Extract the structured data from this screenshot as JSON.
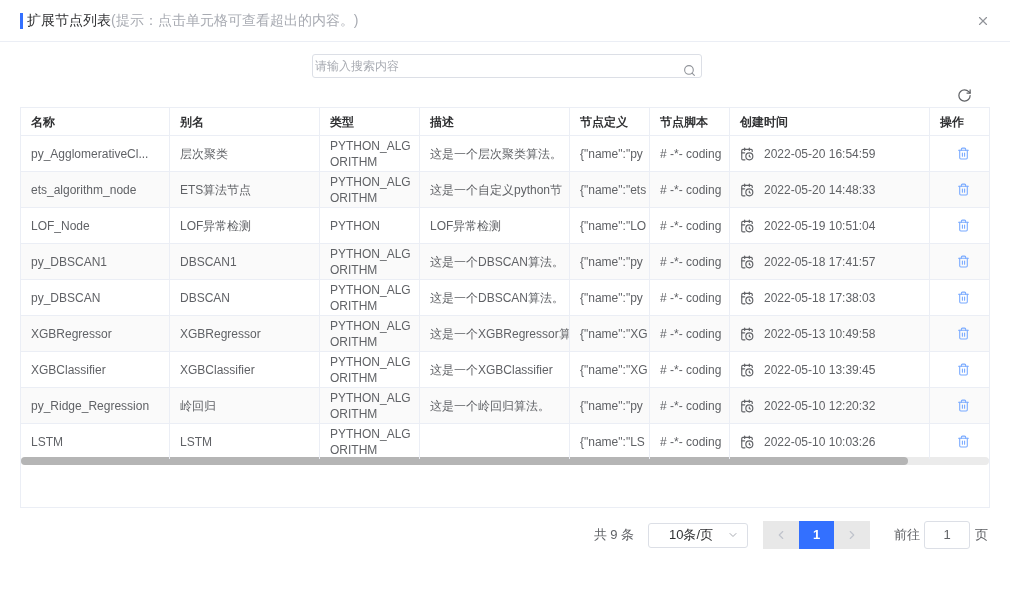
{
  "dialog": {
    "title": "扩展节点列表",
    "hint": "(提示：点击单元格可查看超出的内容。)"
  },
  "search": {
    "placeholder": "请输入搜索内容"
  },
  "table": {
    "columns": [
      "名称",
      "别名",
      "类型",
      "描述",
      "节点定义",
      "节点脚本",
      "创建时间",
      "操作"
    ],
    "rows": [
      {
        "name": "py_AgglomerativeCl...",
        "alias": "层次聚类",
        "type": "PYTHON_ALGORITHM",
        "description": "这是一个层次聚类算法。",
        "definition": "{\"name\":\"py",
        "script": "# -*- coding",
        "created": "2022-05-20 16:54:59"
      },
      {
        "name": "ets_algorithm_node",
        "alias": "ETS算法节点",
        "type": "PYTHON_ALGORITHM",
        "description": "这是一个自定义python节",
        "definition": "{\"name\":\"ets",
        "script": "# -*- coding",
        "created": "2022-05-20 14:48:33"
      },
      {
        "name": "LOF_Node",
        "alias": "LOF异常检测",
        "type": "PYTHON",
        "description": "LOF异常检测",
        "definition": "{\"name\":\"LO",
        "script": "# -*- coding",
        "created": "2022-05-19 10:51:04"
      },
      {
        "name": "py_DBSCAN1",
        "alias": "DBSCAN1",
        "type": "PYTHON_ALGORITHM",
        "description": "这是一个DBSCAN算法。",
        "definition": "{\"name\":\"py",
        "script": "# -*- coding",
        "created": "2022-05-18 17:41:57"
      },
      {
        "name": "py_DBSCAN",
        "alias": "DBSCAN",
        "type": "PYTHON_ALGORITHM",
        "description": "这是一个DBSCAN算法。",
        "definition": "{\"name\":\"py",
        "script": "# -*- coding",
        "created": "2022-05-18 17:38:03"
      },
      {
        "name": "XGBRegressor",
        "alias": "XGBRegressor",
        "type": "PYTHON_ALGORITHM",
        "description": "这是一个XGBRegressor算",
        "definition": "{\"name\":\"XG",
        "script": "# -*- coding",
        "created": "2022-05-13 10:49:58"
      },
      {
        "name": "XGBClassifier",
        "alias": "XGBClassifier",
        "type": "PYTHON_ALGORITHM",
        "description": "这是一个XGBClassifier",
        "definition": "{\"name\":\"XG",
        "script": "# -*- coding",
        "created": "2022-05-10 13:39:45"
      },
      {
        "name": "py_Ridge_Regression",
        "alias": "岭回归",
        "type": "PYTHON_ALGORITHM",
        "description": "这是一个岭回归算法。",
        "definition": "{\"name\":\"py",
        "script": "# -*- coding",
        "created": "2022-05-10 12:20:32"
      },
      {
        "name": "LSTM",
        "alias": "LSTM",
        "type": "PYTHON_ALGORITHM",
        "description": "",
        "definition": "{\"name\":\"LS",
        "script": "# -*- coding",
        "created": "2022-05-10 10:03:26"
      }
    ]
  },
  "pagination": {
    "total": "共 9 条",
    "page_size": "10条/页",
    "pages": [
      {
        "label": "1",
        "selected": true
      }
    ],
    "goto_label": "前往",
    "goto_value": "1",
    "page_suffix": "页"
  }
}
